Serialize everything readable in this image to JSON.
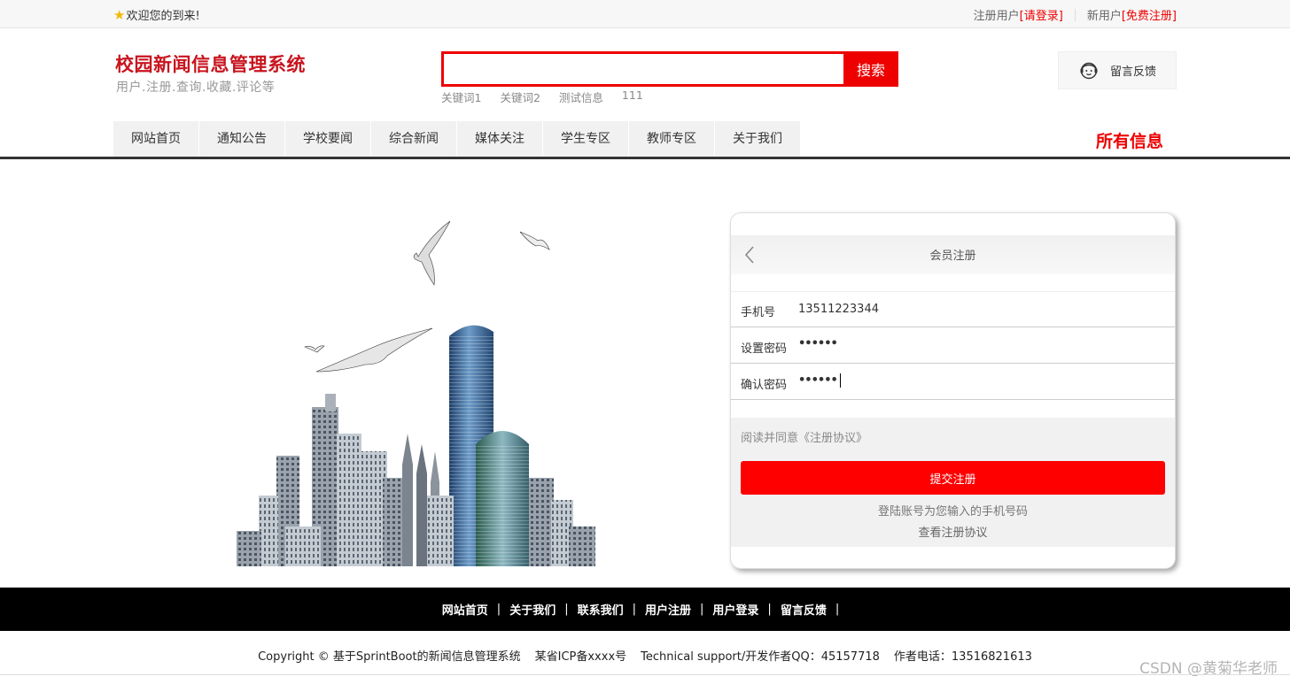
{
  "topbar": {
    "welcome": "欢迎您的到来!",
    "registered_user": "注册用户",
    "login_link": "[请登录]",
    "new_user": "新用户",
    "register_link": "[免费注册]"
  },
  "header": {
    "title": "校园新闻信息管理系统",
    "subtitle": "用户.注册.查询.收藏.评论等",
    "search": {
      "placeholder": "",
      "button": "搜索"
    },
    "hotwords": [
      "关键词1",
      "关键词2",
      "测试信息",
      "111"
    ],
    "feedback": "留言反馈"
  },
  "nav": {
    "items": [
      "网站首页",
      "通知公告",
      "学校要闻",
      "综合新闻",
      "媒体关注",
      "学生专区",
      "教师专区",
      "关于我们"
    ],
    "all_info": "所有信息"
  },
  "register": {
    "title": "会员注册",
    "fields": [
      {
        "label": "手机号",
        "value": "13511223344"
      },
      {
        "label": "设置密码",
        "value": "••••••"
      },
      {
        "label": "确认密码",
        "value": "••••••"
      }
    ],
    "agree": "阅读并同意《注册协议》",
    "submit": "提交注册",
    "hint": "登陆账号为您输入的手机号码",
    "protocol_link": "查看注册协议"
  },
  "footer": {
    "links": [
      "网站首页",
      "关于我们",
      "联系我们",
      "用户注册",
      "用户登录",
      "留言反馈"
    ],
    "copyright": "Copyright © 基于SprintBoot的新闻信息管理系统",
    "icp": "某省ICP备xxxx号",
    "support": "Technical support/开发作者QQ：45157718",
    "phone": "作者电话：13516821613"
  },
  "watermark": "CSDN @黄菊华老师",
  "colors": {
    "accent": "#e00000",
    "nav_bg": "#f1f1f1",
    "footer_bg": "#000000"
  }
}
